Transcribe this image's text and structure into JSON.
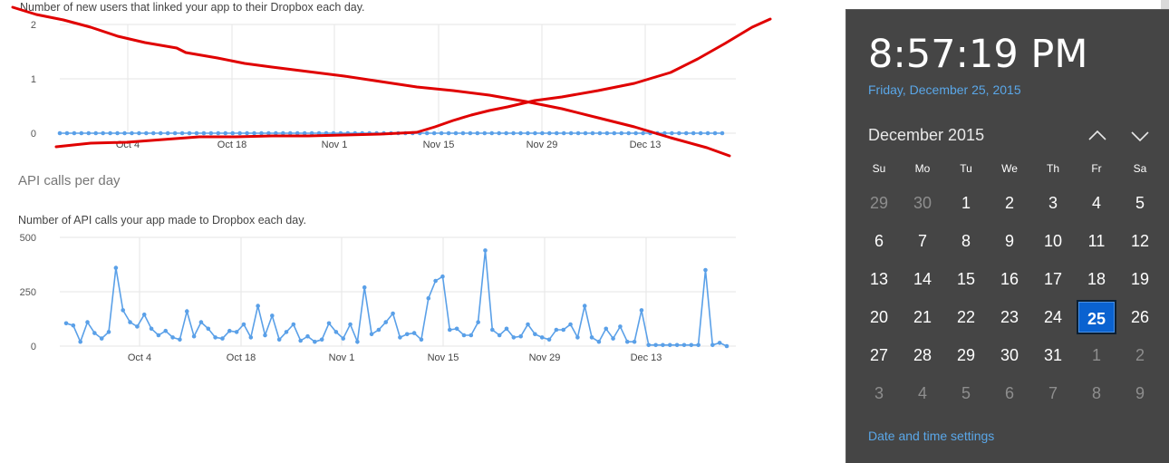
{
  "chart1": {
    "caption": "Number of new users that linked your app to their Dropbox each day.",
    "yticks": [
      "0",
      "1",
      "2"
    ],
    "xticks": [
      "Oct 4",
      "Oct 18",
      "Nov 1",
      "Nov 15",
      "Nov 29",
      "Dec 13"
    ]
  },
  "chart2": {
    "section_title": "API calls per day",
    "caption": "Number of API calls your app made to Dropbox each day.",
    "yticks": [
      "0",
      "250",
      "500"
    ],
    "xticks": [
      "Oct 4",
      "Oct 18",
      "Nov 1",
      "Nov 15",
      "Nov 29",
      "Dec 13"
    ]
  },
  "chart_data": [
    {
      "type": "line",
      "title": "",
      "subtitle": "Number of new users that linked your app to their Dropbox each day.",
      "xlabel": "",
      "ylabel": "",
      "ylim": [
        0,
        2
      ],
      "xlim": [
        "Sep 24",
        "Dec 26"
      ],
      "grid": true,
      "series": [
        {
          "values": [
            0,
            0,
            0,
            0,
            0,
            0,
            0,
            0,
            0,
            0,
            0,
            0,
            0,
            0,
            0,
            0,
            0,
            0,
            0,
            0,
            0,
            0,
            0,
            0,
            0,
            0,
            0,
            0,
            0,
            0,
            0,
            0,
            0,
            0,
            0,
            0,
            0,
            0,
            0,
            0,
            0,
            0,
            0,
            0,
            0,
            0,
            0,
            0,
            0,
            0,
            0,
            0,
            0,
            0,
            0,
            0,
            0,
            0,
            0,
            0,
            0,
            0,
            0,
            0,
            0,
            0,
            0,
            0,
            0,
            0,
            0,
            0,
            0,
            0,
            0,
            0,
            0,
            0,
            0,
            0,
            0,
            0,
            0,
            0,
            0,
            0,
            0,
            0,
            0,
            0,
            0,
            0,
            0
          ]
        }
      ],
      "color": "#5aa0e8"
    },
    {
      "type": "line",
      "title": "API calls per day",
      "subtitle": "Number of API calls your app made to Dropbox each day.",
      "xlabel": "",
      "ylabel": "",
      "ylim": [
        0,
        500
      ],
      "xlim": [
        "Sep 24",
        "Dec 26"
      ],
      "grid": true,
      "series": [
        {
          "values": [
            105,
            95,
            20,
            110,
            60,
            35,
            65,
            360,
            165,
            110,
            90,
            145,
            80,
            50,
            70,
            40,
            30,
            160,
            45,
            110,
            80,
            40,
            35,
            70,
            65,
            100,
            40,
            185,
            50,
            140,
            30,
            65,
            100,
            25,
            45,
            20,
            30,
            105,
            65,
            35,
            100,
            20,
            270,
            55,
            75,
            110,
            150,
            40,
            55,
            60,
            30,
            220,
            300,
            320,
            75,
            80,
            50,
            50,
            110,
            440,
            75,
            50,
            80,
            40,
            45,
            100,
            55,
            40,
            30,
            75,
            75,
            100,
            40,
            185,
            40,
            20,
            80,
            35,
            90,
            20,
            20,
            165,
            5,
            5,
            5,
            5,
            5,
            5,
            5,
            5,
            350,
            5,
            15,
            0
          ]
        }
      ],
      "color": "#5aa0e8"
    }
  ],
  "clock": {
    "time": "8:57:19 PM",
    "date": "Friday, December 25, 2015",
    "month_label": "December 2015",
    "weekdays": [
      "Su",
      "Mo",
      "Tu",
      "We",
      "Th",
      "Fr",
      "Sa"
    ],
    "days": [
      [
        "29",
        "30",
        "1",
        "2",
        "3",
        "4",
        "5"
      ],
      [
        "6",
        "7",
        "8",
        "9",
        "10",
        "11",
        "12"
      ],
      [
        "13",
        "14",
        "15",
        "16",
        "17",
        "18",
        "19"
      ],
      [
        "20",
        "21",
        "22",
        "23",
        "24",
        "25",
        "26"
      ],
      [
        "27",
        "28",
        "29",
        "30",
        "31",
        "1",
        "2"
      ],
      [
        "3",
        "4",
        "5",
        "6",
        "7",
        "8",
        "9"
      ]
    ],
    "current_month_start_index": 2,
    "current_month_end_index": 32,
    "today": "25",
    "settings_link": "Date and time settings",
    "accent_color": "#0a62d0",
    "link_color": "#5aa7e8"
  },
  "annotation": {
    "color": "#e00000",
    "description_lines": 2
  }
}
